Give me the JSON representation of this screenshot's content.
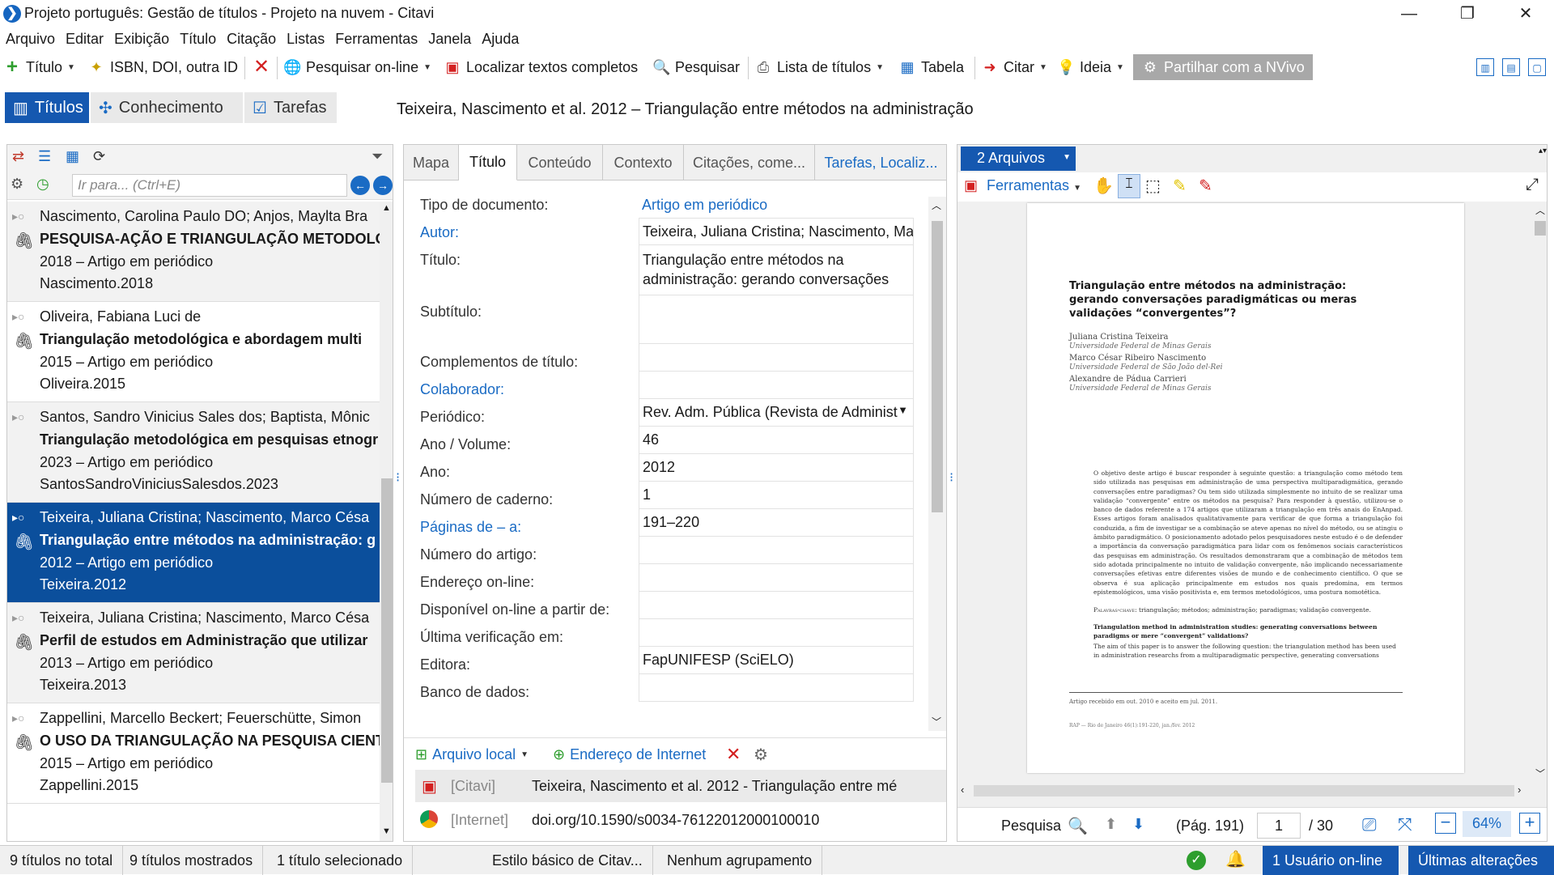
{
  "window": {
    "title": "Projeto português: Gestão de títulos - Projeto na nuvem - Citavi",
    "app_icon": "citavi-logo",
    "controls": [
      "minimize",
      "restore",
      "close"
    ]
  },
  "menu": [
    "Arquivo",
    "Editar",
    "Exibição",
    "Título",
    "Citação",
    "Listas",
    "Ferramentas",
    "Janela",
    "Ajuda"
  ],
  "toolbar": {
    "titulo": "Título",
    "isbn": "ISBN, DOI, outra ID",
    "pesquisar_online": "Pesquisar on-line",
    "localizar": "Localizar textos completos",
    "pesquisar": "Pesquisar",
    "lista_titulos": "Lista de títulos",
    "tabela": "Tabela",
    "citar": "Citar",
    "ideia": "Ideia",
    "nvivo": "Partilhar com a NVivo"
  },
  "nav_tabs": [
    "Títulos",
    "Conhecimento",
    "Tarefas"
  ],
  "reference_header": "Teixeira, Nascimento et al. 2012 – Triangulação entre métodos na administração",
  "left": {
    "search_placeholder": "Ir para... (Ctrl+E)",
    "references": [
      {
        "authors": "Nascimento, Carolina Paulo DO; Anjos, Maylta Bra",
        "title": "PESQUISA-AÇÃO E TRIANGULAÇÃO METODOLÓ",
        "meta": "2018 – Artigo em periódico",
        "key": "Nascimento.2018"
      },
      {
        "authors": "Oliveira, Fabiana Luci de",
        "title": "Triangulação metodológica e abordagem multi",
        "meta": "2015 – Artigo em periódico",
        "key": "Oliveira.2015"
      },
      {
        "authors": "Santos, Sandro Vinicius Sales dos; Baptista, Mônic",
        "title": "Triangulação metodológica em pesquisas etnogr",
        "meta": "2023 – Artigo em periódico",
        "key": "SantosSandroViniciusSalesdos.2023"
      },
      {
        "authors": "Teixeira, Juliana Cristina; Nascimento, Marco Césa",
        "title": "Triangulação entre métodos na administração: g",
        "meta": "2012 – Artigo em periódico",
        "key": "Teixeira.2012"
      },
      {
        "authors": "Teixeira, Juliana Cristina; Nascimento, Marco Césa",
        "title": "Perfil de estudos em Administração que utilizar",
        "meta": "2013 – Artigo em periódico",
        "key": "Teixeira.2013"
      },
      {
        "authors": "Zappellini, Marcello Beckert; Feuerschütte, Simon",
        "title": "O USO DA TRIANGULAÇÃO NA PESQUISA CIENT",
        "meta": "2015 – Artigo em periódico",
        "key": "Zappellini.2015"
      }
    ]
  },
  "middle": {
    "tabs": [
      "Mapa",
      "Título",
      "Conteúdo",
      "Contexto",
      "Citações, come...",
      "Tarefas, Localiz..."
    ],
    "fields": {
      "tipo": {
        "label": "Tipo de documento:",
        "value": "Artigo em periódico"
      },
      "autor": {
        "label": "Autor:",
        "value": "Teixeira, Juliana Cristina; Nascimento, Marco"
      },
      "titulo": {
        "label": "Título:",
        "value": "Triangulação entre métodos na administração: gerando conversações"
      },
      "subtitulo": {
        "label": "Subtítulo:",
        "value": ""
      },
      "complementos": {
        "label": "Complementos de título:",
        "value": ""
      },
      "colaborador": {
        "label": "Colaborador:",
        "value": ""
      },
      "periodico": {
        "label": "Periódico:",
        "value": "Rev. Adm. Pública (Revista de Administ"
      },
      "ano_volume": {
        "label": "Ano / Volume:",
        "value": "46"
      },
      "ano": {
        "label": "Ano:",
        "value": "2012"
      },
      "caderno": {
        "label": "Número de caderno:",
        "value": "1"
      },
      "paginas": {
        "label": "Páginas de – a:",
        "value": "191–220"
      },
      "numero_artigo": {
        "label": "Número do artigo:",
        "value": ""
      },
      "endereco": {
        "label": "Endereço on-line:",
        "value": ""
      },
      "disponivel": {
        "label": "Disponível on-line a partir de:",
        "value": ""
      },
      "ultima": {
        "label": "Última verificação em:",
        "value": ""
      },
      "editora": {
        "label": "Editora:",
        "value": "FapUNIFESP (SciELO)"
      },
      "banco": {
        "label": "Banco de dados:",
        "value": ""
      }
    },
    "attach": {
      "local": "Arquivo local",
      "internet": "Endereço de Internet",
      "rows": [
        {
          "source": "[Citavi]",
          "value": "Teixeira, Nascimento et al. 2012 - Triangulação entre mé"
        },
        {
          "source": "[Internet]",
          "value": "doi.org/10.1590/s0034-76122012000100010"
        }
      ]
    }
  },
  "right": {
    "files": "2 Arquivos",
    "ferramentas": "Ferramentas",
    "pdf": {
      "title": "Triangulação entre métodos na administração: gerando conversações paradigmáticas ou meras validações “convergentes”?",
      "authors": [
        {
          "name": "Juliana Cristina Teixeira",
          "aff": "Universidade Federal de Minas Gerais"
        },
        {
          "name": "Marco César Ribeiro Nascimento",
          "aff": "Universidade Federal de São João del-Rei"
        },
        {
          "name": "Alexandre de Pádua Carrieri",
          "aff": "Universidade Federal de Minas Gerais"
        }
      ],
      "abstract": "O objetivo deste artigo é buscar responder à seguinte questão: a triangulação como método tem sido utilizada nas pesquisas em administração de uma perspectiva multiparadigmática, gerando conversações entre paradigmas? Ou tem sido utilizada simplesmente no intuito de se realizar uma validação “convergente” entre os métodos na pesquisa? Para responder à questão, utilizou-se o banco de dados referente a 174 artigos que utilizaram a triangulação em três anais do EnAnpad. Esses artigos foram analisados qualitativamente para verificar de que forma a triangulação foi conduzida, a fim de investigar se a combinação se ateve apenas no nível do método, ou se atingiu o âmbito paradigmático. O posicionamento adotado pelos pesquisadores neste estudo é o de defender a importância da conversação paradigmática para lidar com os fenômenos sociais característicos das pesquisas em administração. Os resultados demonstraram que a combinação de métodos tem sido adotada principalmente no intuito de validação convergente, não implicando necessariamente conversações efetivas entre diferentes visões de mundo e de conhecimento científico. O que se observa é sua aplicação principalmente em estudos nos quais predomina, em termos epistemológicos, uma visão positivista e, em termos metodológicos, uma postura nomotética.",
      "keywords_label": "Palavras-chave:",
      "keywords": "triangulação; métodos; administração; paradigmas; validação convergente.",
      "en_title": "Triangulation method in administration studies: generating conversations between paradigms or mere “convergent” validations?",
      "en_abstract": "The aim of this paper is to answer the following question: the triangulation method has been used in administration researchs from a multiparadigmatic perspective, generating conversations between",
      "received": "Artigo recebido em out. 2010 e aceito em jul. 2011.",
      "footer": "RAP — Rio de Janeiro 46(1):191-220, jan./fev. 2012"
    },
    "status": {
      "search": "Pesquisa",
      "page_label": "(Pág. 191)",
      "page": "1",
      "total": "/ 30",
      "zoom": "64%"
    }
  },
  "statusbar": {
    "total": "9 títulos no total",
    "shown": "9 títulos mostrados",
    "selected": "1 título selecionado",
    "style": "Estilo básico de Citav...",
    "grouping": "Nenhum agrupamento",
    "users": "1 Usuário on-line",
    "changes": "Últimas alterações"
  },
  "colors": {
    "accent": "#1558b0",
    "link": "#1a6bc4",
    "selected": "#0b4f9c"
  }
}
